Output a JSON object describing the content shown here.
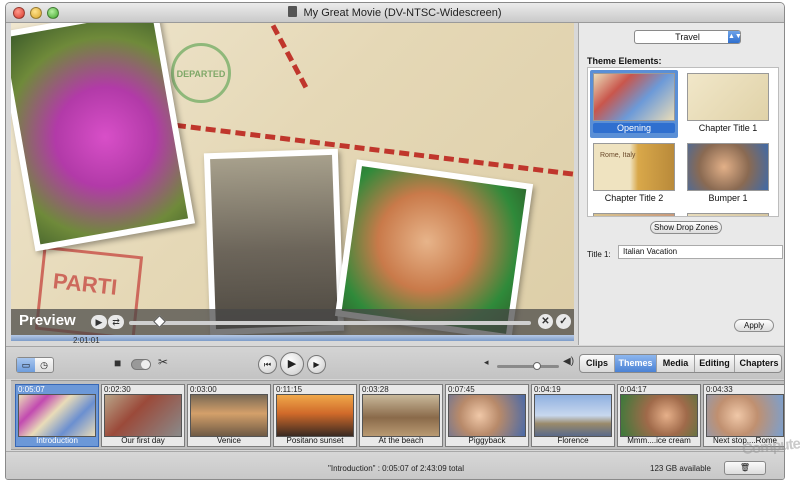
{
  "window": {
    "title": "My Great Movie (DV-NTSC-Widescreen)"
  },
  "preview": {
    "label": "Preview",
    "timecode": "2:01:01",
    "stamp_text": "DEPARTED",
    "postmark_text": "PARTI"
  },
  "panel": {
    "theme_dropdown": "Travel",
    "theme_elements_label": "Theme Elements:",
    "theme_items": [
      {
        "label": "Opening"
      },
      {
        "label": "Chapter Title 1"
      },
      {
        "label": "Chapter Title 2"
      },
      {
        "label": "Bumper 1"
      }
    ],
    "chapter_title2_thumb_text": "Rome, Italy",
    "show_drop_zones": "Show Drop Zones",
    "title1_label": "Title 1:",
    "title1_value": "Italian Vacation",
    "apply": "Apply"
  },
  "toolbar": {
    "tabs": [
      "Clips",
      "Themes",
      "Media",
      "Editing",
      "Chapters"
    ],
    "active_tab": "Themes"
  },
  "clips": [
    {
      "duration": "0:05:07",
      "name": "Introduction"
    },
    {
      "duration": "0:02:30",
      "name": "Our first day"
    },
    {
      "duration": "0:03:00",
      "name": "Venice"
    },
    {
      "duration": "0:11:15",
      "name": "Positano sunset"
    },
    {
      "duration": "0:03:28",
      "name": "At the beach"
    },
    {
      "duration": "0:07:45",
      "name": "Piggyback"
    },
    {
      "duration": "0:04:19",
      "name": "Florence"
    },
    {
      "duration": "0:04:17",
      "name": "Mmm....ice cream"
    },
    {
      "duration": "0:04:33",
      "name": "Next stop....Rome"
    }
  ],
  "status": {
    "text": "\"Introduction\" : 0:05:07 of 2:43:09 total",
    "available": "123 GB available"
  },
  "watermark": "Computer",
  "colors": {
    "accent": "#4b82d5",
    "route": "#c0362c"
  }
}
